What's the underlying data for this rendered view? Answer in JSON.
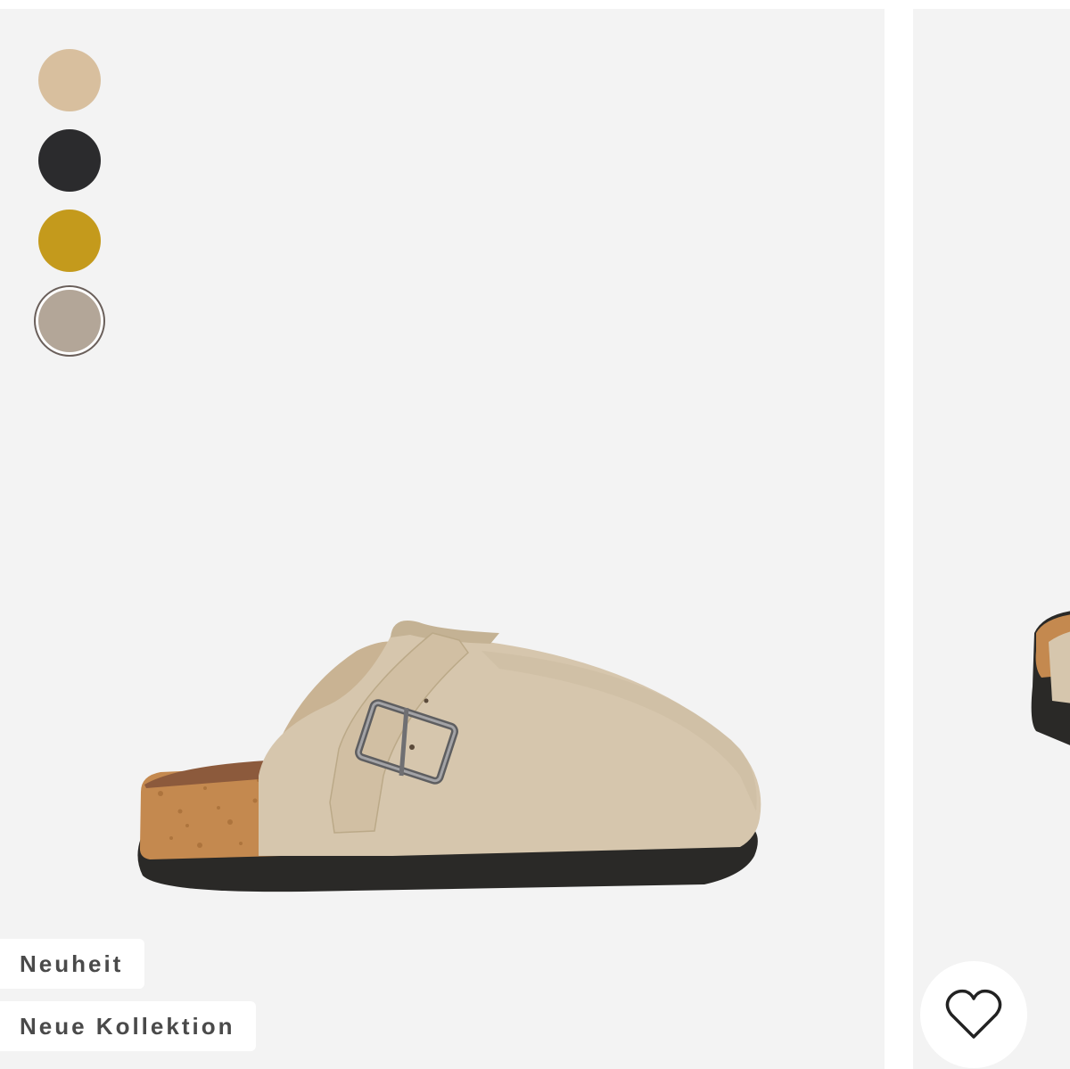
{
  "product_card": {
    "color_swatches": [
      {
        "name": "beige",
        "color": "#d8bf9e"
      },
      {
        "name": "black",
        "color": "#2b2b2d"
      },
      {
        "name": "mustard",
        "color": "#c49a1c"
      },
      {
        "name": "taupe",
        "color": "#b3a698",
        "selected": true
      }
    ],
    "badges": {
      "new": "Neuheit",
      "collection": "Neue Kollektion"
    },
    "image_icon": "clog-shoe-image"
  },
  "next_card": {
    "wishlist_icon": "heart-outline-icon"
  },
  "colors": {
    "card_background": "#f3f3f3",
    "badge_text": "#4a4a4a"
  }
}
